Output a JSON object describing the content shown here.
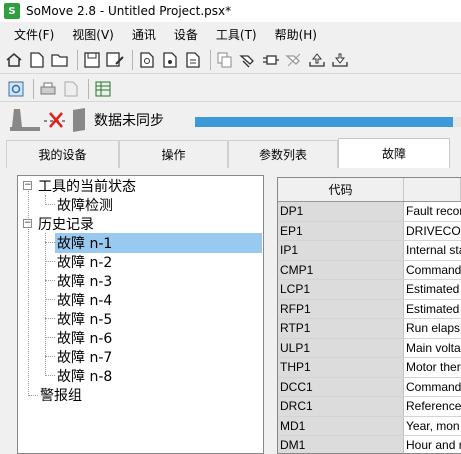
{
  "window": {
    "title": "SoMove 2.8 - Untitled Project.psx*"
  },
  "menu": [
    "文件(F)",
    "视图(V)",
    "通讯",
    "设备",
    "工具(T)",
    "帮助(H)"
  ],
  "status": {
    "text": "数据未同步",
    "progress_fraction": 0.97,
    "accent": "#3d9ad8"
  },
  "tabs": [
    {
      "label": "我的设备",
      "active": false
    },
    {
      "label": "操作",
      "active": false
    },
    {
      "label": "参数列表",
      "active": false
    },
    {
      "label": "故障",
      "active": true
    }
  ],
  "tree": {
    "root1": "工具的当前状态",
    "root1_child": "故障检测",
    "root2": "历史记录",
    "faults": [
      "故障 n-1",
      "故障 n-2",
      "故障 n-3",
      "故障 n-4",
      "故障 n-5",
      "故障 n-6",
      "故障 n-7",
      "故障 n-8"
    ],
    "root3": "警报组",
    "selected": "故障 n-1"
  },
  "grid": {
    "header": {
      "code": "代码",
      "desc": ""
    },
    "rows": [
      {
        "code": "DP1",
        "desc": "Fault recor"
      },
      {
        "code": "EP1",
        "desc": "DRIVECOM"
      },
      {
        "code": "IP1",
        "desc": "Internal sta"
      },
      {
        "code": "CMP1",
        "desc": "Command"
      },
      {
        "code": "LCP1",
        "desc": "Estimated"
      },
      {
        "code": "RFP1",
        "desc": "Estimated"
      },
      {
        "code": "RTP1",
        "desc": "Run elaps"
      },
      {
        "code": "ULP1",
        "desc": "Main voltag"
      },
      {
        "code": "THP1",
        "desc": "Motor therm"
      },
      {
        "code": "DCC1",
        "desc": "Command"
      },
      {
        "code": "DRC1",
        "desc": "Reference"
      },
      {
        "code": "MD1",
        "desc": "Year, mon"
      },
      {
        "code": "DM1",
        "desc": "Hour and r"
      }
    ]
  }
}
